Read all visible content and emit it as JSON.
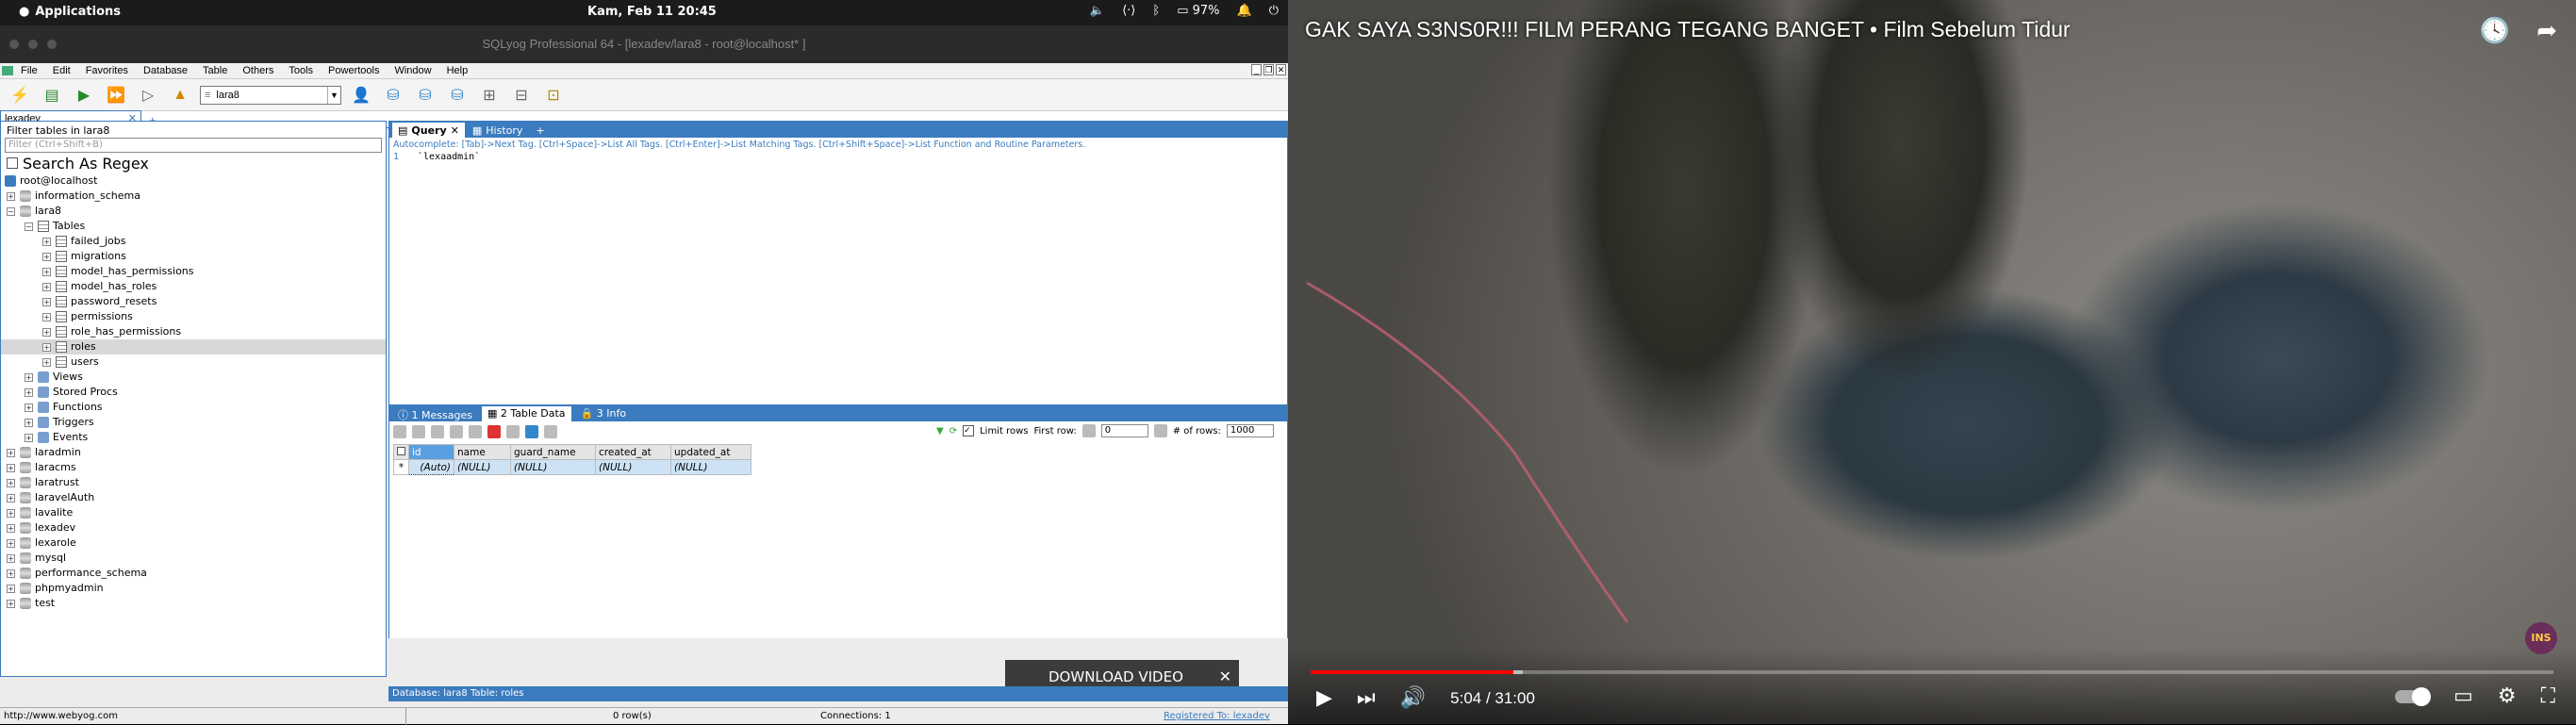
{
  "topbar": {
    "apps": "Applications",
    "clock": "Kam, Feb 11   20:45",
    "battery": "97%"
  },
  "window": {
    "title": "SQLyog Professional 64 - [lexadev/lara8 - root@localhost* ]"
  },
  "menu": [
    "File",
    "Edit",
    "Favorites",
    "Database",
    "Table",
    "Others",
    "Tools",
    "Powertools",
    "Window",
    "Help"
  ],
  "toolbar": {
    "db_select": "lara8"
  },
  "conn_tab": {
    "label": "lexadev"
  },
  "sidebar": {
    "filter_label": "Filter tables in lara8",
    "filter_placeholder": "Filter (Ctrl+Shift+B)",
    "regex_label": "Search As Regex",
    "tree": [
      {
        "label": "root@localhost",
        "level": 0,
        "icon": "server",
        "pm": ""
      },
      {
        "label": "information_schema",
        "level": 0,
        "icon": "db",
        "pm": "+"
      },
      {
        "label": "lara8",
        "level": 0,
        "icon": "db",
        "pm": "-"
      },
      {
        "label": "Tables",
        "level": 1,
        "icon": "tbl",
        "pm": "-"
      },
      {
        "label": "failed_jobs",
        "level": 2,
        "icon": "tbl",
        "pm": "+"
      },
      {
        "label": "migrations",
        "level": 2,
        "icon": "tbl",
        "pm": "+"
      },
      {
        "label": "model_has_permissions",
        "level": 2,
        "icon": "tbl",
        "pm": "+"
      },
      {
        "label": "model_has_roles",
        "level": 2,
        "icon": "tbl",
        "pm": "+"
      },
      {
        "label": "password_resets",
        "level": 2,
        "icon": "tbl",
        "pm": "+"
      },
      {
        "label": "permissions",
        "level": 2,
        "icon": "tbl",
        "pm": "+"
      },
      {
        "label": "role_has_permissions",
        "level": 2,
        "icon": "tbl",
        "pm": "+"
      },
      {
        "label": "roles",
        "level": 2,
        "icon": "tbl",
        "pm": "+",
        "selected": true
      },
      {
        "label": "users",
        "level": 2,
        "icon": "tbl",
        "pm": "+"
      },
      {
        "label": "Views",
        "level": 1,
        "icon": "view",
        "pm": "+"
      },
      {
        "label": "Stored Procs",
        "level": 1,
        "icon": "proc",
        "pm": "+"
      },
      {
        "label": "Functions",
        "level": 1,
        "icon": "func",
        "pm": "+"
      },
      {
        "label": "Triggers",
        "level": 1,
        "icon": "trig",
        "pm": "+"
      },
      {
        "label": "Events",
        "level": 1,
        "icon": "event",
        "pm": "+"
      },
      {
        "label": "laradmin",
        "level": 0,
        "icon": "db",
        "pm": "+"
      },
      {
        "label": "laracms",
        "level": 0,
        "icon": "db",
        "pm": "+"
      },
      {
        "label": "laratrust",
        "level": 0,
        "icon": "db",
        "pm": "+"
      },
      {
        "label": "laravelAuth",
        "level": 0,
        "icon": "db",
        "pm": "+"
      },
      {
        "label": "lavalite",
        "level": 0,
        "icon": "db",
        "pm": "+"
      },
      {
        "label": "lexadev",
        "level": 0,
        "icon": "db",
        "pm": "+"
      },
      {
        "label": "lexarole",
        "level": 0,
        "icon": "db",
        "pm": "+"
      },
      {
        "label": "mysql",
        "level": 0,
        "icon": "db",
        "pm": "+"
      },
      {
        "label": "performance_schema",
        "level": 0,
        "icon": "db",
        "pm": "+"
      },
      {
        "label": "phpmyadmin",
        "level": 0,
        "icon": "db",
        "pm": "+"
      },
      {
        "label": "test",
        "level": 0,
        "icon": "db",
        "pm": "+"
      }
    ]
  },
  "query": {
    "tab_query": "Query",
    "tab_history": "History",
    "autocomplete": "Autocomplete: [Tab]->Next Tag. [Ctrl+Space]->List All Tags. [Ctrl+Enter]->List Matching Tags. [Ctrl+Shift+Space]->List Function and Routine Parameters.",
    "line_no": "1",
    "code": "`lexaadmin`"
  },
  "results": {
    "tab_messages": "1 Messages",
    "tab_data": "2 Table Data",
    "tab_info": "3 Info",
    "limit_rows": "Limit rows",
    "first_row": "First row:",
    "first_row_value": "0",
    "num_rows": "# of rows:",
    "num_rows_value": "1000",
    "columns": [
      "id",
      "name",
      "guard_name",
      "created_at",
      "updated_at"
    ],
    "row_marker": "*",
    "row": [
      "(Auto)",
      "(NULL)",
      "(NULL)",
      "(NULL)",
      "(NULL)"
    ]
  },
  "infobar": "Database: lara8   Table: roles",
  "download": "DOWNLOAD VIDEO",
  "status": {
    "url": "http://www.webyog.com",
    "rows": "0 row(s)",
    "connections": "Connections: 1",
    "registered": "Registered To: lexadev"
  },
  "video": {
    "title": "GAK SAYA S3NS0R!!! FILM PERANG TEGANG BANGET • Film Sebelum Tidur",
    "time": "5:04 / 31:00",
    "progress": 0.1634,
    "buffered": 0.171,
    "watermark": "INS",
    "colors": {
      "progress": "#ff0000"
    }
  }
}
